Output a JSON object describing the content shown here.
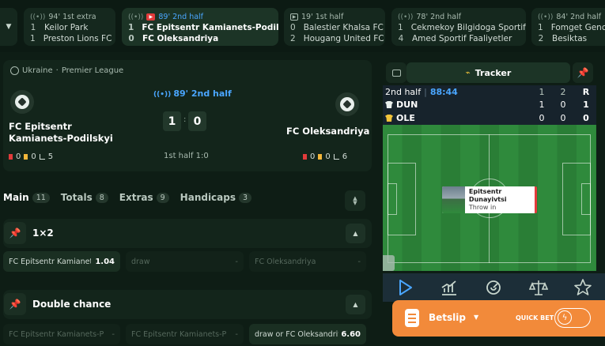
{
  "top_matches": [
    {
      "time": "94' 1st extra",
      "team1": "Keilor Park",
      "team2": "Preston Lions FC",
      "score1": "1",
      "score2": "1",
      "icon": "signal-icon"
    },
    {
      "time": "89' 2nd half",
      "team1": "FC Epitsentr Kamianets-Podilskyi",
      "team2": "FC Oleksandriya",
      "score1": "1",
      "score2": "0",
      "icon": "live-stream-icon"
    },
    {
      "time": "19' 1st half",
      "team1": "Balestier Khalsa FC",
      "team2": "Hougang United FC",
      "score1": "0",
      "score2": "2",
      "icon": "video-icon"
    },
    {
      "time": "78' 2nd half",
      "team1": "Cekmekoy Bilgidoga Sportif",
      "team2": "Amed Sportif Faaliyetler",
      "score1": "1",
      "score2": "4",
      "icon": "signal-icon"
    },
    {
      "time": "84' 2nd half",
      "team1": "Fomget Genc",
      "team2": "Besiktas",
      "score1": "1",
      "score2": "2",
      "icon": "signal-icon"
    }
  ],
  "match": {
    "country": "Ukraine",
    "league": "Premier League",
    "live_time": "89' 2nd half",
    "home": {
      "name": "FC Epitsentr Kamianets-Podilskyi",
      "score": "1",
      "red": "0",
      "yellow": "0",
      "corners": "5"
    },
    "away": {
      "name": "FC Oleksandriya",
      "score": "0",
      "red": "0",
      "yellow": "0",
      "corners": "6"
    },
    "half_score": "1st half 1:0",
    "separator": ":"
  },
  "tabs": [
    {
      "label": "Main",
      "count": "11"
    },
    {
      "label": "Totals",
      "count": "8"
    },
    {
      "label": "Extras",
      "count": "9"
    },
    {
      "label": "Handicaps",
      "count": "3"
    }
  ],
  "markets": [
    {
      "title": "1×2",
      "outcomes": [
        {
          "label": "FC Epitsentr Kamianets-Podilskyi",
          "price": "1.04"
        },
        {
          "label": "draw",
          "price": "-"
        },
        {
          "label": "FC Oleksandriya",
          "price": "-"
        }
      ]
    },
    {
      "title": "Double chance",
      "outcomes": [
        {
          "label": "FC Epitsentr Kamianets-Podilskyi or draw",
          "price": "-"
        },
        {
          "label": "FC Epitsentr Kamianets-Podilskyi or FC Oleksandriya",
          "price": "-"
        },
        {
          "label": "draw or FC Oleksandriya",
          "price": "6.60"
        }
      ]
    }
  ],
  "tracker": {
    "tab_label": "Tracker",
    "period": "2nd half",
    "clock": "88:44",
    "headers": [
      "1",
      "2",
      "R"
    ],
    "rows": [
      {
        "team": "DUN",
        "p1": "1",
        "p2": "0",
        "r": "1"
      },
      {
        "team": "OLE",
        "p1": "0",
        "p2": "0",
        "r": "0"
      }
    ],
    "event_team": "Epitsentr Dunayivtsi",
    "event_type": "Throw in"
  },
  "betslip": {
    "title": "Betslip",
    "quick_bet": "QUICK BET"
  },
  "colors": {
    "accent_live": "#4aa6ff",
    "betslip": "#f28a3a",
    "pitch": "#2f8a3c",
    "red": "#e23b3b"
  }
}
